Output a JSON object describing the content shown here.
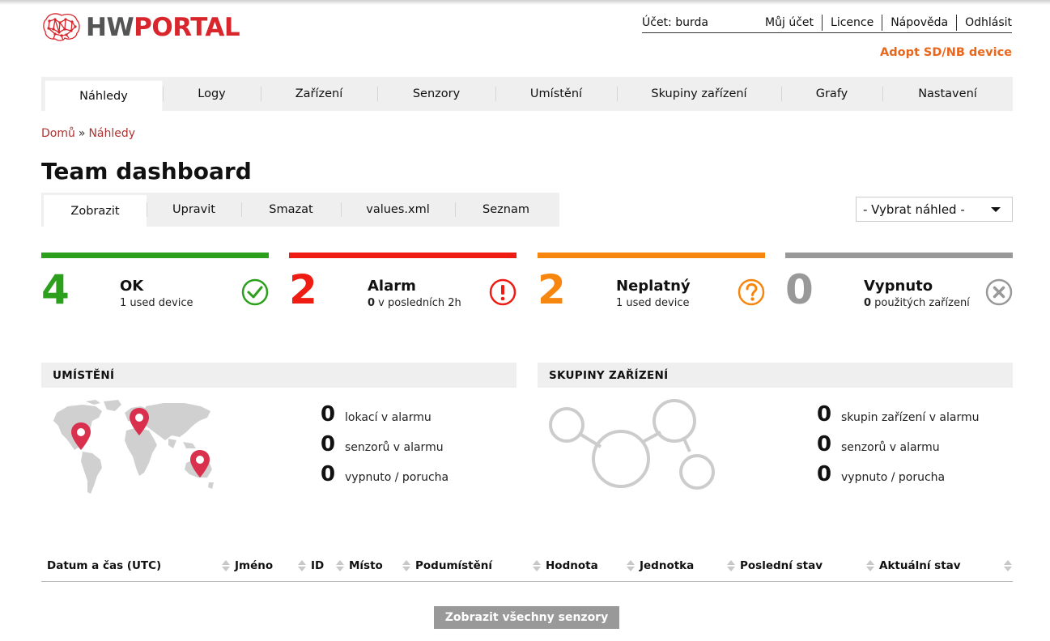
{
  "brand": {
    "part1": "HW",
    "part2": "PORTAL",
    "color": "#d9262c"
  },
  "user_nav": {
    "account": "Účet: burda",
    "links": [
      "Můj účet",
      "Licence",
      "Nápověda",
      "Odhlásit"
    ]
  },
  "adopt_link": "Adopt SD/NB device",
  "main_nav": [
    "Náhledy",
    "Logy",
    "Zařízení",
    "Senzory",
    "Umístění",
    "Skupiny zařízení",
    "Grafy",
    "Nastavení"
  ],
  "main_nav_active": "Náhledy",
  "breadcrumb": {
    "home": "Domů",
    "separator": "»",
    "current": "Náhledy"
  },
  "page_title": "Team dashboard",
  "sub_nav": [
    "Zobrazit",
    "Upravit",
    "Smazat",
    "values.xml",
    "Seznam"
  ],
  "sub_nav_active": "Zobrazit",
  "view_select": {
    "value": "- Vybrat náhled -"
  },
  "status_cards": [
    {
      "count": "4",
      "label": "OK",
      "sub_bold": "",
      "sub": "1 used device",
      "color": "#2ca01c",
      "icon": "check-circle-icon"
    },
    {
      "count": "2",
      "label": "Alarm",
      "sub_bold": "0",
      "sub": " v posledních 2h",
      "color": "#ee1c12",
      "icon": "exclamation-circle-icon"
    },
    {
      "count": "2",
      "label": "Neplatný",
      "sub_bold": "",
      "sub": "1 used device",
      "color": "#f7860e",
      "icon": "question-circle-icon"
    },
    {
      "count": "0",
      "label": "Vypnuto",
      "sub_bold": "0",
      "sub": " použitých zařízení",
      "color": "#999999",
      "icon": "x-circle-icon"
    }
  ],
  "locations": {
    "title": "UMÍSTĚNÍ",
    "icon": "world-map-icon",
    "stats": [
      {
        "n": "0",
        "text": "lokací v alarmu"
      },
      {
        "n": "0",
        "text": "senzorů v alarmu"
      },
      {
        "n": "0",
        "text": "vypnuto / porucha"
      }
    ]
  },
  "groups": {
    "title": "SKUPINY ZAŘÍZENÍ",
    "icon": "network-circles-icon",
    "stats": [
      {
        "n": "0",
        "text": "skupin zařízení v alarmu"
      },
      {
        "n": "0",
        "text": "senzorů v alarmu"
      },
      {
        "n": "0",
        "text": "vypnuto / porucha"
      }
    ]
  },
  "table": {
    "columns": [
      "Datum a čas (UTC)",
      "Jméno",
      "ID",
      "Místo",
      "Podumístění",
      "Hodnota",
      "Jednotka",
      "Poslední stav",
      "Aktuální stav"
    ]
  },
  "show_all_button": "Zobrazit všechny senzory"
}
